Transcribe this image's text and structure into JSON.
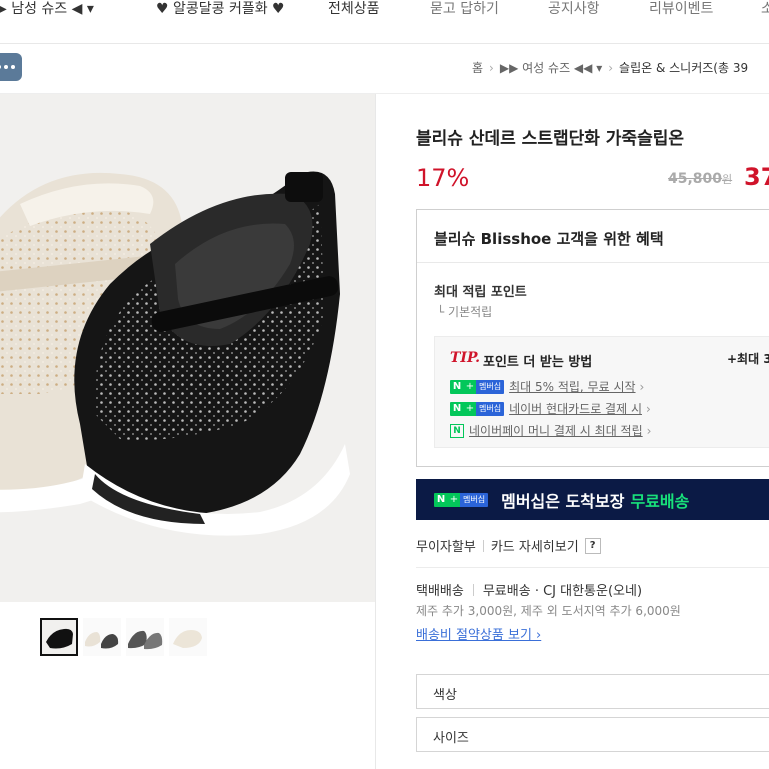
{
  "nav": {
    "items": [
      {
        "label": "▶ 남성 슈즈 ◀ ▾",
        "faded": false
      },
      {
        "label": "♥ 알콩달콩 커플화 ♥",
        "faded": false
      },
      {
        "label": "전체상품",
        "faded": false
      },
      {
        "label": "묻고 답하기",
        "faded": true
      },
      {
        "label": "공지사항",
        "faded": true
      },
      {
        "label": "리뷰이벤트",
        "faded": true
      },
      {
        "label": "소",
        "faded": true
      }
    ]
  },
  "breadcrumb": {
    "home": "홈",
    "category": "▶▶ 여성 슈즈 ◀◀ ▾",
    "current": "슬립온 & 스니커즈(총 39"
  },
  "product": {
    "title": "블리슈 산데르 스트랩단화 가죽슬립온",
    "discount": "17%",
    "original_price": "45,800",
    "original_price_unit": "원",
    "sale_price": "37"
  },
  "benefits": {
    "title": "블리슈 Blisshoe 고객을 위한 혜택",
    "points_title": "최대 적립 포인트",
    "points_sub": "└ 기본적립",
    "tip_label": "TIP.",
    "tip_text": "포인트 더 받는 방법",
    "tip_max": "+최대 3",
    "rows": [
      {
        "badge": "membership",
        "text": "최대 5% 적립, 무료 시작"
      },
      {
        "badge": "membership",
        "text": "네이버 현대카드로 결제 시"
      },
      {
        "badge": "npay",
        "text": "네이버페이 머니 결제 시 최대 적립"
      }
    ],
    "badge_n": "N",
    "badge_plus": "+",
    "badge_mem": "멤버십",
    "badge_pay": "N"
  },
  "banner": {
    "text": "멤버십은 도착보장",
    "accent": "무료배송"
  },
  "payment": {
    "installment": "무이자할부",
    "card_detail": "카드 자세히보기",
    "help": "?"
  },
  "shipping": {
    "type": "택배배송",
    "info": "무료배송 · CJ 대한통운(오네)",
    "extra": "제주 추가 3,000원, 제주 외 도서지역 추가 6,000원",
    "link": "배송비 절약상품 보기 ›"
  },
  "options": {
    "color": "색상",
    "size": "사이즈"
  },
  "colors": {
    "sale_red": "#d0132a",
    "naver_green": "#03c75a",
    "banner_navy": "#0b1a45"
  }
}
